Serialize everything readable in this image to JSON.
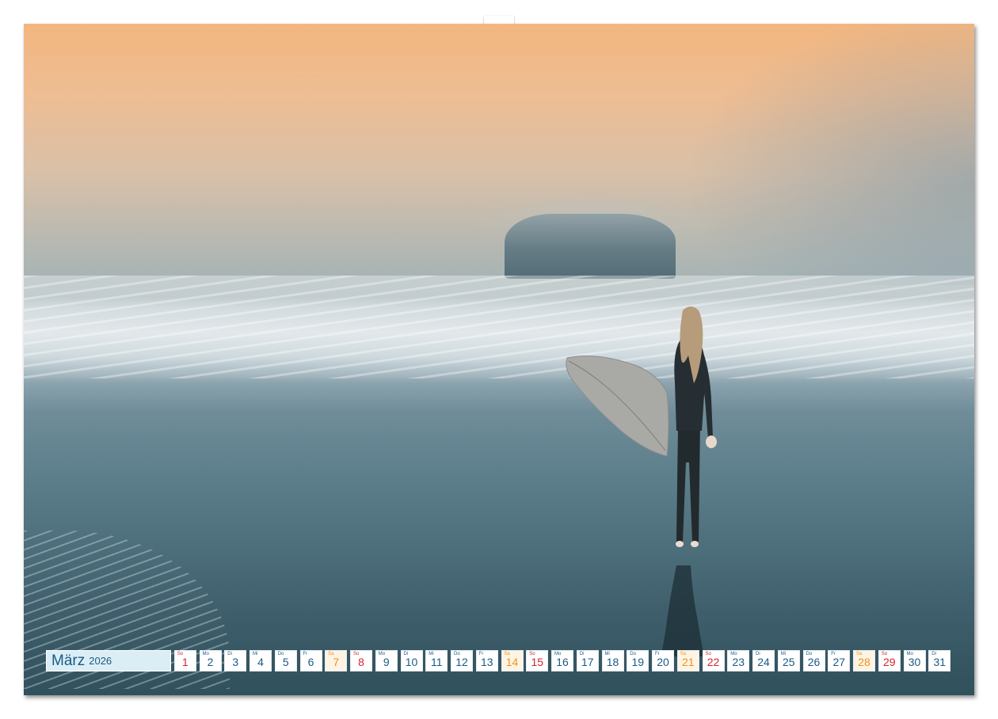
{
  "calendar": {
    "month": "März",
    "year": "2026",
    "days": [
      {
        "wd": "So",
        "n": "1",
        "type": "sun"
      },
      {
        "wd": "Mo",
        "n": "2",
        "type": "week"
      },
      {
        "wd": "Di",
        "n": "3",
        "type": "week"
      },
      {
        "wd": "Mi",
        "n": "4",
        "type": "week"
      },
      {
        "wd": "Do",
        "n": "5",
        "type": "week"
      },
      {
        "wd": "Fr",
        "n": "6",
        "type": "week"
      },
      {
        "wd": "Sa",
        "n": "7",
        "type": "sat"
      },
      {
        "wd": "So",
        "n": "8",
        "type": "sun"
      },
      {
        "wd": "Mo",
        "n": "9",
        "type": "week"
      },
      {
        "wd": "Di",
        "n": "10",
        "type": "week"
      },
      {
        "wd": "Mi",
        "n": "11",
        "type": "week"
      },
      {
        "wd": "Do",
        "n": "12",
        "type": "week"
      },
      {
        "wd": "Fr",
        "n": "13",
        "type": "week"
      },
      {
        "wd": "Sa",
        "n": "14",
        "type": "sat"
      },
      {
        "wd": "So",
        "n": "15",
        "type": "sun"
      },
      {
        "wd": "Mo",
        "n": "16",
        "type": "week"
      },
      {
        "wd": "Di",
        "n": "17",
        "type": "week"
      },
      {
        "wd": "Mi",
        "n": "18",
        "type": "week"
      },
      {
        "wd": "Do",
        "n": "19",
        "type": "week"
      },
      {
        "wd": "Fr",
        "n": "20",
        "type": "week"
      },
      {
        "wd": "Sa",
        "n": "21",
        "type": "sat"
      },
      {
        "wd": "So",
        "n": "22",
        "type": "sun"
      },
      {
        "wd": "Mo",
        "n": "23",
        "type": "week"
      },
      {
        "wd": "Di",
        "n": "24",
        "type": "week"
      },
      {
        "wd": "Mi",
        "n": "25",
        "type": "week"
      },
      {
        "wd": "Do",
        "n": "26",
        "type": "week"
      },
      {
        "wd": "Fr",
        "n": "27",
        "type": "week"
      },
      {
        "wd": "Sa",
        "n": "28",
        "type": "sat"
      },
      {
        "wd": "So",
        "n": "29",
        "type": "sun"
      },
      {
        "wd": "Mo",
        "n": "30",
        "type": "week"
      },
      {
        "wd": "Di",
        "n": "31",
        "type": "week"
      }
    ]
  },
  "colors": {
    "weekday": "#1b5a86",
    "saturday": "#e8951b",
    "sunday": "#d4242f"
  },
  "photo": {
    "subject": "surfer-with-board-icon"
  }
}
